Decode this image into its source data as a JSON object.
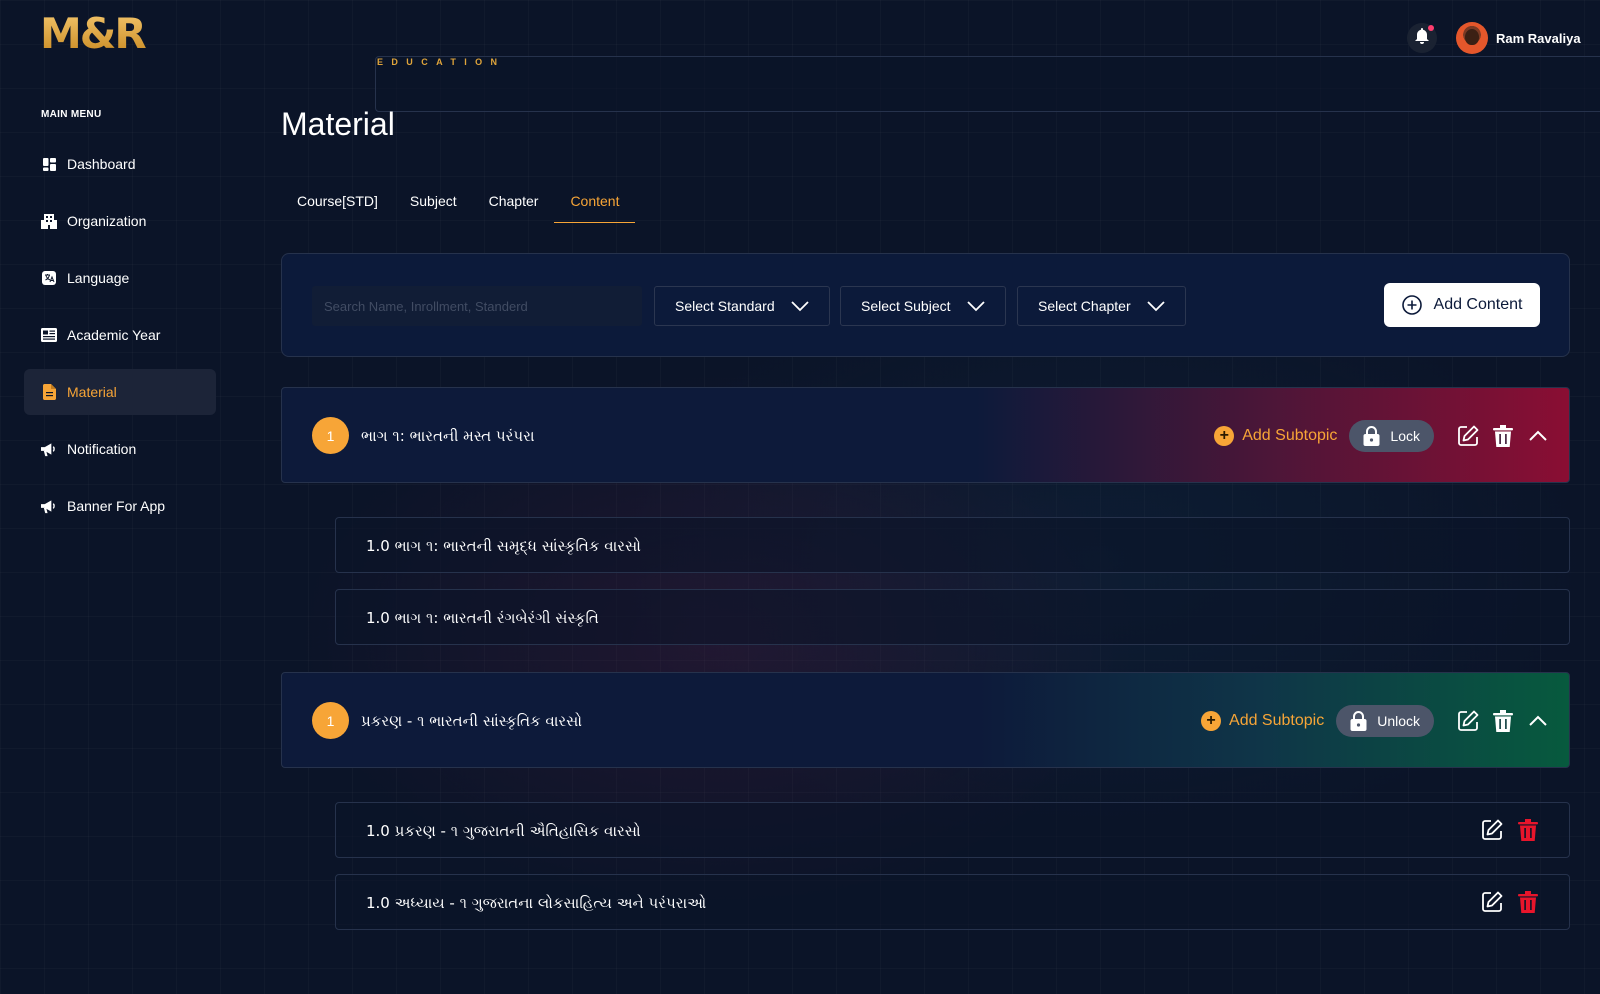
{
  "brand": {
    "logo_text": "M&R",
    "logo_sub": "EDUCATION",
    "accent": "#f7a537"
  },
  "header": {
    "user_name": "Ram Ravaliya",
    "notification_icon": "bell-icon"
  },
  "sidebar": {
    "title": "MAIN MENU",
    "items": [
      {
        "label": "Dashboard",
        "icon": "dashboard-icon"
      },
      {
        "label": "Organization",
        "icon": "building-icon"
      },
      {
        "label": "Language",
        "icon": "translate-icon"
      },
      {
        "label": "Academic Year",
        "icon": "newspaper-icon"
      },
      {
        "label": "Material",
        "icon": "document-icon",
        "active": true
      },
      {
        "label": "Notification",
        "icon": "megaphone-icon"
      },
      {
        "label": "Banner For App",
        "icon": "megaphone-icon"
      }
    ]
  },
  "page": {
    "title": "Material",
    "tabs": [
      {
        "label": "Course[STD]"
      },
      {
        "label": "Subject"
      },
      {
        "label": "Chapter"
      },
      {
        "label": "Content",
        "active": true
      }
    ]
  },
  "filters": {
    "search_placeholder": "Search Name, Inrollment, Standerd",
    "standard": "Select Standard",
    "subject": "Select Subject",
    "chapter": "Select Chapter",
    "add_content_label": "Add Content"
  },
  "topics": [
    {
      "number": "1",
      "title": "ભાગ ૧: ભારતની મસ્ત પરંપરા",
      "add_subtopic_label": "Add Subtopic",
      "lock_label": "Lock",
      "status_color": "#8a0e33",
      "subtopics": [
        {
          "title": "1.0 ભાગ ૧: ભારતની સમૃદ્ધ સાંસ્કૃતિક વારસો"
        },
        {
          "title": "1.0 ભાગ ૧: ભારતની રંગબેરંગી સંસ્કૃતિ"
        }
      ]
    },
    {
      "number": "1",
      "title": "પ્રકરણ - ૧  ભારતની સાંસ્કૃતિક વારસો",
      "add_subtopic_label": "Add Subtopic",
      "lock_label": "Unlock",
      "status_color": "#075a3e",
      "subtopics": [
        {
          "title": "1.0 પ્રકરણ - ૧  ગુજરાતની ઐતિહાસિક વારસો"
        },
        {
          "title": "1.0 અધ્યાય - ૧  ગુજરાતના લોકસાહિત્ય અને પરંપરાઓ"
        }
      ]
    }
  ]
}
